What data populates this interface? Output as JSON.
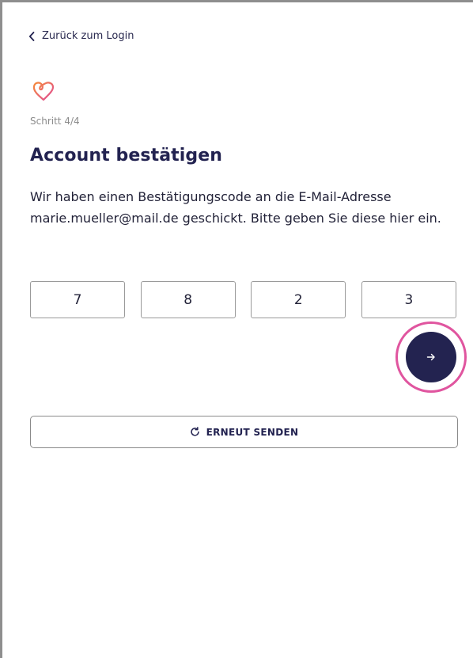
{
  "nav": {
    "back_label": "Zurück zum Login",
    "back_icon": "chevron-left-icon"
  },
  "logo": {
    "icon": "heart-icon",
    "gradient": [
      "#f58a3a",
      "#e04a9a"
    ]
  },
  "step": "Schritt 4/4",
  "title": "Account bestätigen",
  "description": "Wir haben einen Bestätigungscode an die E-Mail-Adresse marie.mueller@mail.de geschickt. Bitte geben Sie diese hier ein.",
  "code": {
    "digits": [
      "7",
      "8",
      "2",
      "3"
    ]
  },
  "submit": {
    "icon": "arrow-right-icon",
    "button_color": "#232350",
    "highlight_color": "#e0559f"
  },
  "resend": {
    "label": "ERNEUT SENDEN",
    "icon": "refresh-icon"
  }
}
